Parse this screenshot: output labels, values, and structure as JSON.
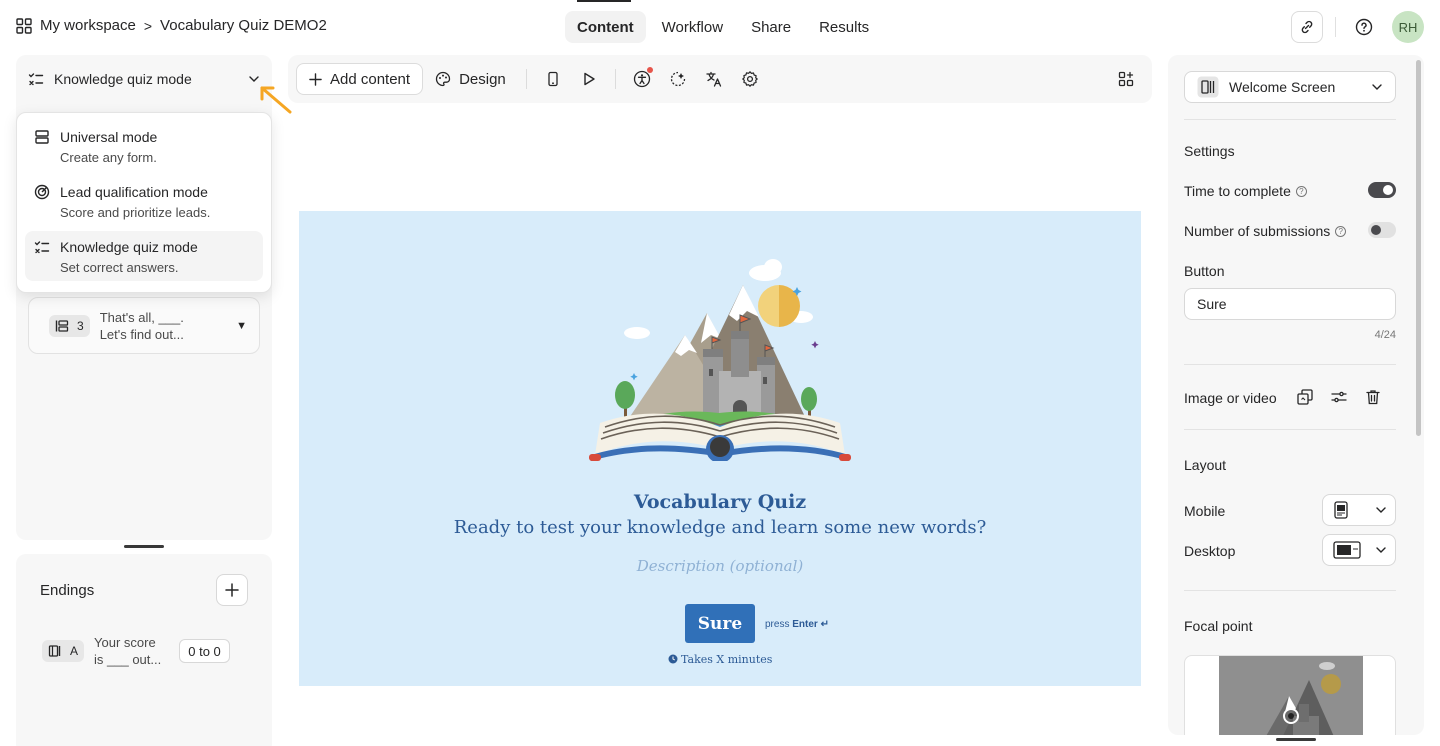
{
  "breadcrumb": {
    "workspace": "My workspace",
    "separator": ">",
    "form": "Vocabulary Quiz DEMO2"
  },
  "tabs": [
    {
      "label": "Content",
      "active": true
    },
    {
      "label": "Workflow",
      "active": false
    },
    {
      "label": "Share",
      "active": false
    },
    {
      "label": "Results",
      "active": false
    }
  ],
  "user": {
    "initials": "RH"
  },
  "mode_select": {
    "selected": "Knowledge quiz mode"
  },
  "mode_dropdown": [
    {
      "title": "Universal mode",
      "subtitle": "Create any form."
    },
    {
      "title": "Lead qualification mode",
      "subtitle": "Score and prioritize leads."
    },
    {
      "title": "Knowledge quiz mode",
      "subtitle": "Set correct answers."
    }
  ],
  "question": {
    "number": "3",
    "line1": "That's all, ___.",
    "line2": "Let's find out..."
  },
  "endings": {
    "title": "Endings",
    "item": {
      "badge": "A",
      "line1": "Your score",
      "line2": "is ___ out...",
      "range": "0 to 0"
    }
  },
  "toolbar": {
    "add_content": "Add content",
    "design": "Design"
  },
  "canvas": {
    "title": "Vocabulary Quiz",
    "subtitle": "Ready to test your knowledge and learn some new words?",
    "description_placeholder": "Description (optional)",
    "button": "Sure",
    "press": "press",
    "enter": "Enter ↵",
    "takes": "Takes X minutes",
    "background": "#d8ecfa",
    "accent": "#3070b8"
  },
  "right_panel": {
    "screen_select": "Welcome Screen",
    "settings_heading": "Settings",
    "time_to_complete": "Time to complete",
    "time_to_complete_on": true,
    "number_of_submissions": "Number of submissions",
    "number_of_submissions_on": false,
    "button_label": "Button",
    "button_value": "Sure",
    "counter": "4/24",
    "image_or_video": "Image or video",
    "layout_heading": "Layout",
    "mobile": "Mobile",
    "desktop": "Desktop",
    "focal_point": "Focal point"
  }
}
